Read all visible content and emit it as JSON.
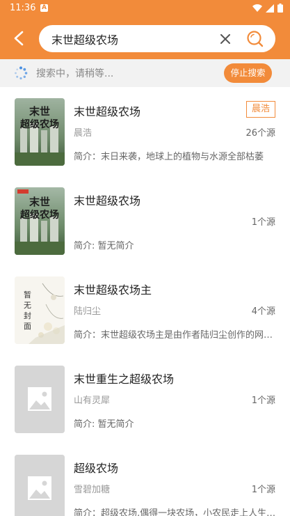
{
  "status_bar": {
    "time": "11:36",
    "notification_letter": "A"
  },
  "search": {
    "query": "末世超级农场"
  },
  "progress": {
    "text": "搜索中，请稍等...",
    "stop_label": "停止搜索"
  },
  "colors": {
    "accent": "#f28b3a",
    "placeholder_cover": "#d6d6d6"
  },
  "results": [
    {
      "title": "末世超级农场",
      "author": "晨浩",
      "sources": "26个源",
      "intro": "简介：末日来袭，地球上的植物与水源全部枯萎",
      "tag": "晨浩",
      "cover": "image",
      "cover_text": "末世超级农场"
    },
    {
      "title": "末世超级农场",
      "author": "",
      "sources": "1个源",
      "intro": "简介: 暂无简介",
      "cover": "image",
      "cover_text": "末世超级农场"
    },
    {
      "title": "末世超级农场主",
      "author": "陆归尘",
      "sources": "4个源",
      "intro": "简介：末世超级农场主是由作者陆归尘创作的网络小说",
      "cover": "placeholder-art",
      "cover_text": "暂无封面"
    },
    {
      "title": "末世重生之超级农场",
      "author": "山有灵犀",
      "sources": "1个源",
      "intro": "简介: 暂无简介",
      "cover": "image-icon"
    },
    {
      "title": "超级农场",
      "author": "雪碧加糖",
      "sources": "1个源",
      "intro": "简介：超级农场,偶得一块农场，小农民走上人生巅峰",
      "cover": "image-icon"
    }
  ]
}
